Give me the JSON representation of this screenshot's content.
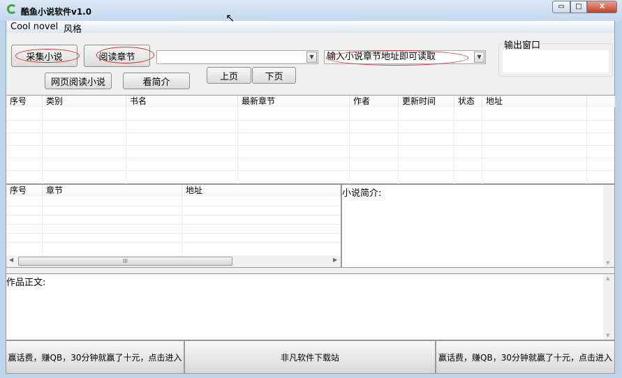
{
  "window": {
    "title": "酷鱼小说软件v1.0",
    "minimize": "▭",
    "maximize": "□",
    "close": "X"
  },
  "menu": [
    "Cool novel",
    "风格"
  ],
  "toolbar": {
    "collect": "采集小说",
    "read_chapter": "阅读章节",
    "web_read": "网页阅读小说",
    "view_intro": "看简介",
    "prev_page": "上页",
    "next_page": "下页",
    "url_combo_value": "",
    "chapter_combo_value": "输入小说章节地址即可读取"
  },
  "output": {
    "label": "输出窗口"
  },
  "novel_table": {
    "columns": [
      "序号",
      "类别",
      "书名",
      "最新章节",
      "作者",
      "更新时间",
      "状态",
      "地址"
    ]
  },
  "chapter_table": {
    "columns": [
      "序号",
      "章节",
      "地址"
    ],
    "scroll_grip": "III"
  },
  "intro": {
    "label": "小说简介:"
  },
  "content": {
    "label": "作品正文:"
  },
  "footer": {
    "left": "赢话费，赚QB，30分钟就赢了十元，点击进入",
    "center": "非凡软件下载站",
    "right": "赢话费，赚QB，30分钟就赢了十元，点击进入"
  }
}
